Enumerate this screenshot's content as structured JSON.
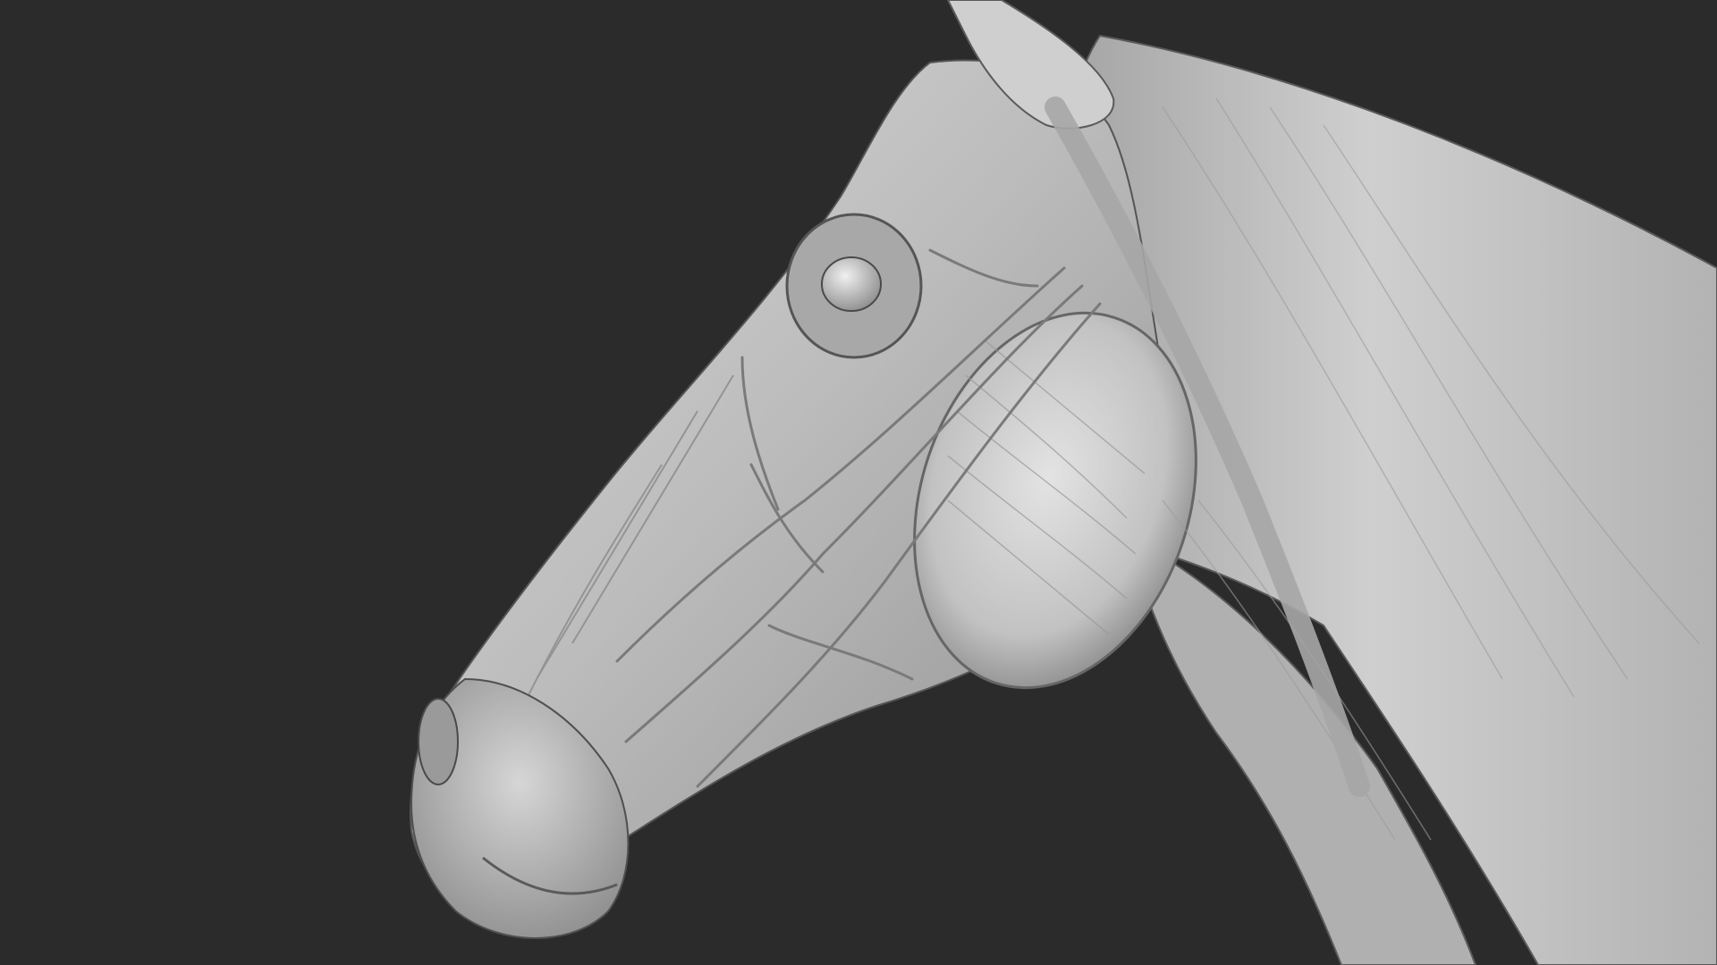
{
  "scene": {
    "background_color": "#2b2b2b",
    "model_base_color": "#bdbdbd",
    "model_highlight_color": "#e6e6e6",
    "model_shadow_color": "#6e6e6e",
    "subject": "horse-head-muscle-sculpt"
  }
}
